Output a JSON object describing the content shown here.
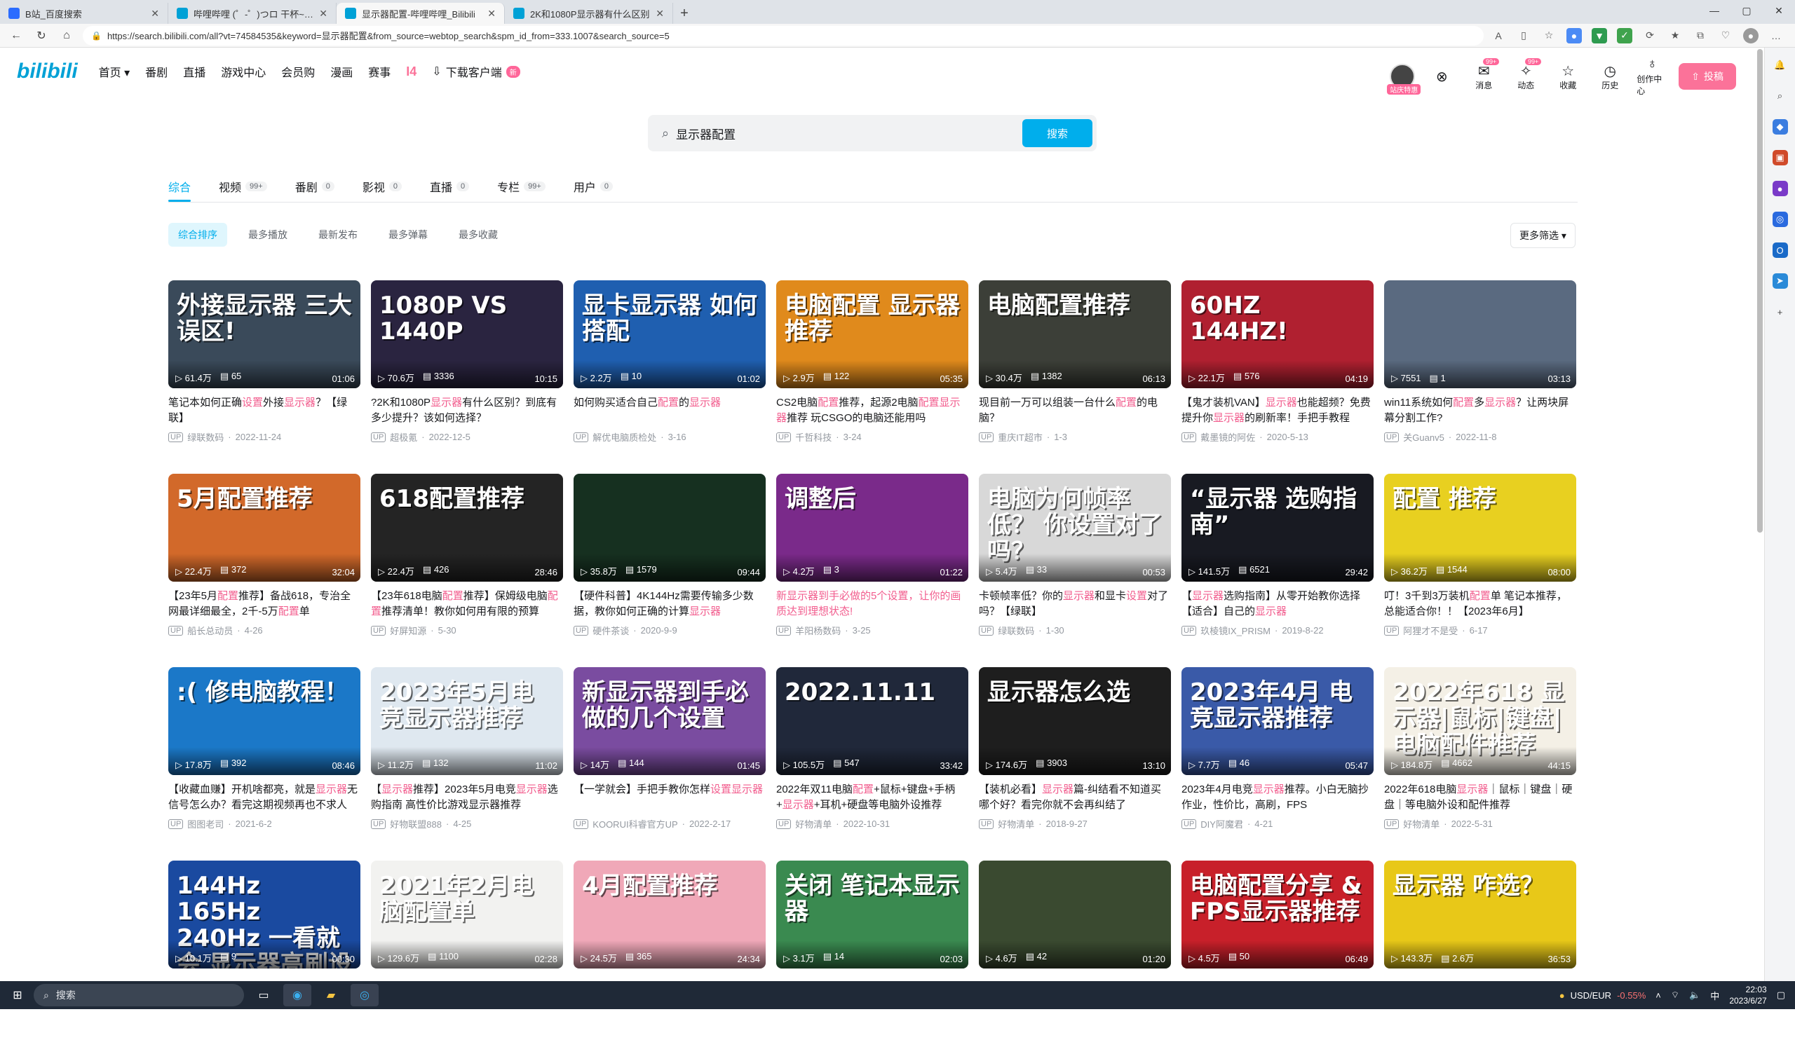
{
  "browser": {
    "tabs": [
      {
        "label": "B站_百度搜索",
        "color": "#2b6cff"
      },
      {
        "label": "哔哩哔哩 (゜-゜)つロ 干杯~-bilibili",
        "color": "#00a1d6"
      },
      {
        "label": "显示器配置-哔哩哔哩_Bilibili",
        "color": "#00a1d6"
      },
      {
        "label": "2K和1080P显示器有什么区别",
        "color": "#00a1d6"
      }
    ],
    "url": "https://search.bilibili.com/all?vt=74584535&keyword=显示器配置&from_source=webtop_search&spm_id_from=333.1007&search_source=5"
  },
  "header": {
    "logo": "bilibili",
    "nav": [
      "首页",
      "番剧",
      "直播",
      "游戏中心",
      "会员购",
      "漫画",
      "赛事"
    ],
    "download": "下载客户端",
    "download_badge": "新",
    "avatar_tag": "站庆特惠",
    "right_items": [
      {
        "label": "大会员",
        "badge": ""
      },
      {
        "label": "消息",
        "badge": "99+"
      },
      {
        "label": "动态",
        "badge": "99+"
      },
      {
        "label": "收藏",
        "badge": ""
      },
      {
        "label": "历史",
        "badge": ""
      },
      {
        "label": "创作中心",
        "badge": ""
      }
    ],
    "upload": "投稿"
  },
  "search": {
    "value": "显示器配置",
    "button": "搜索"
  },
  "type_tabs": [
    {
      "label": "综合",
      "count": ""
    },
    {
      "label": "视频",
      "count": "99+"
    },
    {
      "label": "番剧",
      "count": "0"
    },
    {
      "label": "影视",
      "count": "0"
    },
    {
      "label": "直播",
      "count": "0"
    },
    {
      "label": "专栏",
      "count": "99+"
    },
    {
      "label": "用户",
      "count": "0"
    }
  ],
  "sort": [
    "综合排序",
    "最多播放",
    "最新发布",
    "最多弹幕",
    "最多收藏"
  ],
  "more_filter": "更多筛选",
  "videos": [
    {
      "overlay": "外接显示器 三大误区!",
      "bg": "#3a4a5a",
      "views": "61.4万",
      "danmaku": "65",
      "duration": "01:06",
      "title_pre": "笔记本如何正确",
      "hl": "设置",
      "title_mid": "外接",
      "hl2": "显示器",
      "title_post": "？【绿联】",
      "author": "绿联数码",
      "date": "2022-11-24"
    },
    {
      "overlay": "1080P VS 1440P",
      "bg": "#2a2440",
      "views": "70.6万",
      "danmaku": "3336",
      "duration": "10:15",
      "title_pre": "?2K和1080P",
      "hl": "显示器",
      "title_mid": "有什么区别？到底有多少提升？该如何选择？",
      "hl2": "",
      "title_post": "",
      "author": "超极氪",
      "date": "2022-12-5"
    },
    {
      "overlay": "显卡显示器 如何搭配",
      "bg": "#1f5fb0",
      "views": "2.2万",
      "danmaku": "10",
      "duration": "01:02",
      "title_pre": "如何购买适合自己",
      "hl": "配置",
      "title_mid": "的",
      "hl2": "显示器",
      "title_post": "",
      "author": "解优电脑质检处",
      "date": "3-16"
    },
    {
      "overlay": "电脑配置 显示器 推荐",
      "bg": "#e08a1c",
      "views": "2.9万",
      "danmaku": "122",
      "duration": "05:35",
      "title_pre": "CS2电脑",
      "hl": "配置",
      "title_mid": "推荐，起源2电脑",
      "hl2": "配置显示器",
      "title_post": "推荐 玩CSGO的电脑还能用吗",
      "author": "千哲科技",
      "date": "3-24"
    },
    {
      "overlay": "电脑配置推荐",
      "bg": "#3c3f38",
      "views": "30.4万",
      "danmaku": "1382",
      "duration": "06:13",
      "title_pre": "现目前一万可以组装一台什么",
      "hl": "配置",
      "title_mid": "的电脑？",
      "hl2": "",
      "title_post": "",
      "author": "重庆IT超市",
      "date": "1-3"
    },
    {
      "overlay": "60HZ 144HZ!",
      "bg": "#b02030",
      "views": "22.1万",
      "danmaku": "576",
      "duration": "04:19",
      "title_pre": "【鬼才装机VAN】",
      "hl": "显示器",
      "title_mid": "也能超频？免费提升你",
      "hl2": "显示器",
      "title_post": "的刷新率！手把手教程",
      "author": "戴墨镜的阿佐",
      "date": "2020-5-13"
    },
    {
      "overlay": "",
      "bg": "#5a6a80",
      "views": "7551",
      "danmaku": "1",
      "duration": "03:13",
      "title_pre": "win11系统如何",
      "hl": "配置",
      "title_mid": "多",
      "hl2": "显示器",
      "title_post": "？让两块屏幕分割工作?",
      "author": "关Guanv5",
      "date": "2022-11-8"
    },
    {
      "overlay": "5月配置推荐",
      "bg": "#d2692a",
      "views": "22.4万",
      "danmaku": "372",
      "duration": "32:04",
      "title_pre": "【23年5月",
      "hl": "配置",
      "title_mid": "推荐】备战618，专治全网最详细最全，2千-5万",
      "hl2": "配置",
      "title_post": "单",
      "author": "船长总动员",
      "date": "4-26"
    },
    {
      "overlay": "618配置推荐",
      "bg": "#242424",
      "views": "22.4万",
      "danmaku": "426",
      "duration": "28:46",
      "title_pre": "【23年618电脑",
      "hl": "配置",
      "title_mid": "推荐】保姆级电脑",
      "hl2": "配置",
      "title_post": "推荐清单！教你如何用有限的预算",
      "author": "好屏知源",
      "date": "5-30"
    },
    {
      "overlay": "",
      "bg": "#163020",
      "views": "35.8万",
      "danmaku": "1579",
      "duration": "09:44",
      "title_pre": "【硬件科普】4K144Hz需要传输多少数据，教你如何正确的计算",
      "hl": "显示器",
      "title_mid": "",
      "hl2": "",
      "title_post": "",
      "author": "硬件茶谈",
      "date": "2020-9-9"
    },
    {
      "overlay": "调整后",
      "bg": "#7a2a8a",
      "views": "4.2万",
      "danmaku": "3",
      "duration": "01:22",
      "title_pre": "",
      "hl": "新显示器到手必做的5个设置，让你的画质达到理想状态!",
      "title_mid": "",
      "hl2": "",
      "title_post": "",
      "author": "羊阳杨数码",
      "date": "3-25"
    },
    {
      "overlay": "电脑为何帧率低？ 你设置对了吗？",
      "bg": "#d8d8d8",
      "views": "5.4万",
      "danmaku": "33",
      "duration": "00:53",
      "title_pre": "卡顿帧率低？你的",
      "hl": "显示器",
      "title_mid": "和显卡",
      "hl2": "设置",
      "title_post": "对了吗？【绿联】",
      "author": "绿联数码",
      "date": "1-30"
    },
    {
      "overlay": "“显示器 选购指南”",
      "bg": "#181a22",
      "views": "141.5万",
      "danmaku": "6521",
      "duration": "29:42",
      "title_pre": "【",
      "hl": "显示器",
      "title_mid": "选购指南】从零开始教你选择【适合】自己的",
      "hl2": "显示器",
      "title_post": "",
      "author": "玖棱镜IX_PRISM",
      "date": "2019-8-22"
    },
    {
      "overlay": "配置 推荐",
      "bg": "#e8d020",
      "views": "36.2万",
      "danmaku": "1544",
      "duration": "08:00",
      "title_pre": "叮！3千到3万装机",
      "hl": "配置",
      "title_mid": "单 笔记本推荐，总能适合你！！【2023年6月】",
      "hl2": "",
      "title_post": "",
      "author": "阿狸才不是受",
      "date": "6-17"
    },
    {
      "overlay": ":( 修电脑教程！",
      "bg": "#1b78c8",
      "views": "17.8万",
      "danmaku": "392",
      "duration": "08:46",
      "title_pre": "【收藏血赚】开机啥都亮，就是",
      "hl": "显示器",
      "title_mid": "无信号怎么办？看完这期视频再也不求人",
      "hl2": "",
      "title_post": "",
      "author": "图图老司",
      "date": "2021-6-2"
    },
    {
      "overlay": "2023年5月电竞显示器推荐",
      "bg": "#dfe8f0",
      "views": "11.2万",
      "danmaku": "132",
      "duration": "11:02",
      "title_pre": "【",
      "hl": "显示器",
      "title_mid": "推荐】2023年5月电竞",
      "hl2": "显示器",
      "title_post": "选购指南 高性价比游戏显示器推荐",
      "author": "好物联盟888",
      "date": "4-25"
    },
    {
      "overlay": "新显示器到手必做的几个设置",
      "bg": "#7a4ca0",
      "views": "14万",
      "danmaku": "144",
      "duration": "01:45",
      "title_pre": "【一学就会】手把手教你怎样",
      "hl": "设置显示器",
      "title_mid": "",
      "hl2": "",
      "title_post": "",
      "author": "KOORUI科睿官方UP",
      "date": "2022-2-17"
    },
    {
      "overlay": "2022.11.11",
      "bg": "#20283a",
      "views": "105.5万",
      "danmaku": "547",
      "duration": "33:42",
      "title_pre": "2022年双11电脑",
      "hl": "配置",
      "title_mid": "+鼠标+键盘+手柄+",
      "hl2": "显示器",
      "title_post": "+耳机+硬盘等电脑外设推荐",
      "author": "好物清单",
      "date": "2022-10-31"
    },
    {
      "overlay": "显示器怎么选",
      "bg": "#1e1e1e",
      "views": "174.6万",
      "danmaku": "3903",
      "duration": "13:10",
      "title_pre": "【装机必看】",
      "hl": "显示器",
      "title_mid": "篇-纠结看不知道买哪个好？看完你就不会再纠结了",
      "hl2": "",
      "title_post": "",
      "author": "好物清单",
      "date": "2018-9-27"
    },
    {
      "overlay": "2023年4月 电竞显示器推荐",
      "bg": "#3a5aa8",
      "views": "7.7万",
      "danmaku": "46",
      "duration": "05:47",
      "title_pre": "2023年4月电竞",
      "hl": "显示器",
      "title_mid": "推荐。小白无脑抄作业，性价比，高刷，FPS",
      "hl2": "",
      "title_post": "",
      "author": "DIY阿魔君",
      "date": "4-21"
    },
    {
      "overlay": "2022年618 显示器|鼠标|键盘|电脑配件推荐",
      "bg": "#f4f0e6",
      "views": "184.8万",
      "danmaku": "4662",
      "duration": "44:15",
      "title_pre": "2022年618电脑",
      "hl": "显示器",
      "title_mid": "｜鼠标｜键盘｜硬盘｜等电脑外设和配件推荐",
      "hl2": "",
      "title_post": "",
      "author": "好物清单",
      "date": "2022-5-31"
    },
    {
      "overlay": "144Hz 165Hz 240Hz 一看就会 显示器高刷设置",
      "bg": "#1a4aa0",
      "views": "10.1万",
      "danmaku": "9",
      "duration": "00:30",
      "title_pre": "",
      "hl": "",
      "title_mid": "",
      "hl2": "",
      "title_post": "",
      "author": "",
      "date": ""
    },
    {
      "overlay": "2021年2月电脑配置单",
      "bg": "#f2f2f0",
      "views": "129.6万",
      "danmaku": "1100",
      "duration": "02:28",
      "title_pre": "",
      "hl": "",
      "title_mid": "",
      "hl2": "",
      "title_post": "",
      "author": "",
      "date": ""
    },
    {
      "overlay": "4月配置推荐",
      "bg": "#f0a8b8",
      "views": "24.5万",
      "danmaku": "365",
      "duration": "24:34",
      "title_pre": "",
      "hl": "",
      "title_mid": "",
      "hl2": "",
      "title_post": "",
      "author": "",
      "date": ""
    },
    {
      "overlay": "关闭 笔记本显示器",
      "bg": "#3a8a50",
      "views": "3.1万",
      "danmaku": "14",
      "duration": "02:03",
      "title_pre": "",
      "hl": "",
      "title_mid": "",
      "hl2": "",
      "title_post": "",
      "author": "",
      "date": ""
    },
    {
      "overlay": "",
      "bg": "#3a4a30",
      "views": "4.6万",
      "danmaku": "42",
      "duration": "01:20",
      "title_pre": "",
      "hl": "",
      "title_mid": "",
      "hl2": "",
      "title_post": "",
      "author": "",
      "date": ""
    },
    {
      "overlay": "电脑配置分享 & FPS显示器推荐",
      "bg": "#c8202a",
      "views": "4.5万",
      "danmaku": "50",
      "duration": "06:49",
      "title_pre": "",
      "hl": "",
      "title_mid": "",
      "hl2": "",
      "title_post": "",
      "author": "",
      "date": ""
    },
    {
      "overlay": "显示器 咋选？",
      "bg": "#e8c818",
      "views": "143.3万",
      "danmaku": "2.6万",
      "duration": "36:53",
      "title_pre": "",
      "hl": "",
      "title_mid": "",
      "hl2": "",
      "title_post": "",
      "author": "",
      "date": ""
    }
  ],
  "taskbar": {
    "search": "搜索",
    "fx_label": "USD/EUR",
    "fx_change": "-0.55%",
    "ime": "中",
    "time": "22:03",
    "date": "2023/6/27"
  }
}
